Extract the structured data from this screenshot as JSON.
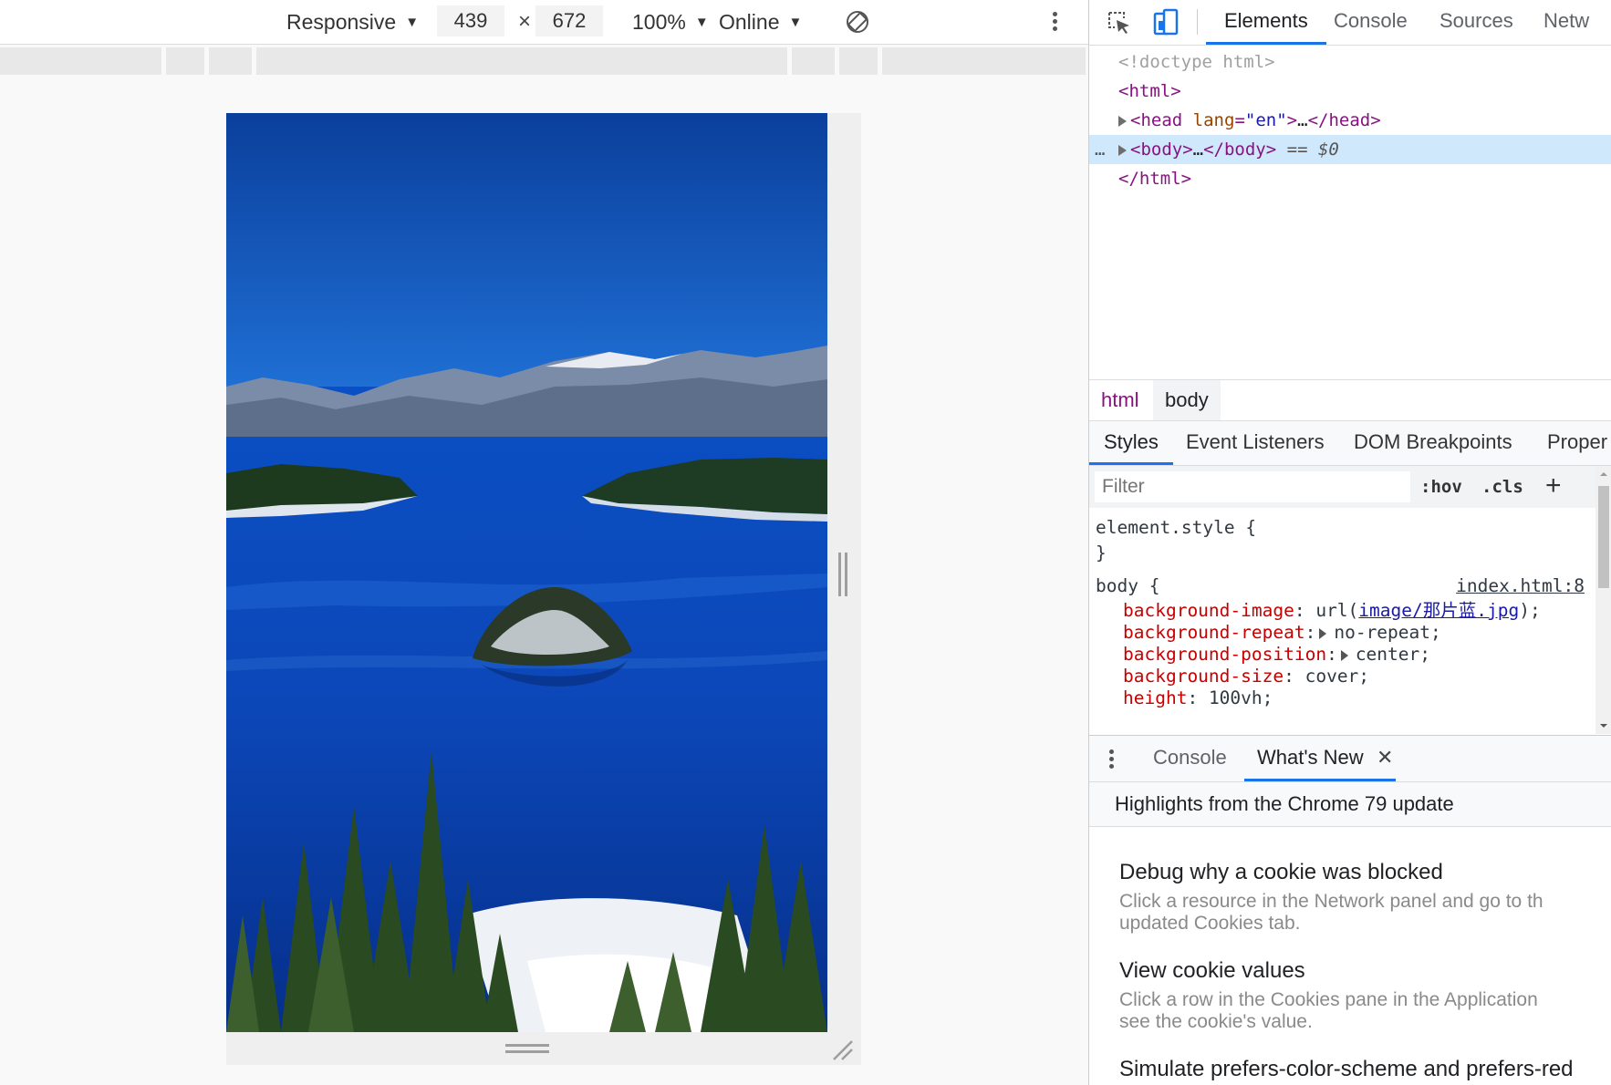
{
  "device_toolbar": {
    "device": "Responsive",
    "width": "439",
    "height": "672",
    "times": "×",
    "zoom": "100%",
    "throttle": "Online"
  },
  "devtools": {
    "tabs": [
      "Elements",
      "Console",
      "Sources",
      "Netw"
    ],
    "active_tab": "Elements"
  },
  "dom_tree": {
    "doctype": "<!doctype html>",
    "html_open": "<html>",
    "head_tag": "head",
    "head_attr_name": "lang",
    "head_attr_value": "\"en\"",
    "ellipsis": "…",
    "head_close": "</head>",
    "body_open": "<body>",
    "body_close": "</body>",
    "equals": "==",
    "dollar": "$0",
    "html_close": "</html>",
    "selected_dots": "…"
  },
  "breadcrumbs": [
    "html",
    "body"
  ],
  "styles_tabs": [
    "Styles",
    "Event Listeners",
    "DOM Breakpoints",
    "Proper"
  ],
  "styles_filter": {
    "placeholder": "Filter",
    "hov": ":hov",
    "cls": ".cls",
    "plus": "+"
  },
  "rules": {
    "element_style_open": "element.style {",
    "element_style_close": "}",
    "body_selector": "body {",
    "body_source": "index.html:8",
    "declarations": [
      {
        "prop": "background-image",
        "pre": "url(",
        "link": "image/那片蓝.jpg",
        "post": ");"
      },
      {
        "prop": "background-repeat",
        "value": "no-repeat;"
      },
      {
        "prop": "background-position",
        "value": "center;"
      },
      {
        "prop": "background-size",
        "value": "cover;"
      },
      {
        "prop": "height",
        "value": "100vh;"
      }
    ]
  },
  "drawer": {
    "tabs": [
      "Console",
      "What's New"
    ],
    "active_tab": "What's New",
    "close": "✕",
    "highlights": "Highlights from the Chrome 79 update",
    "items": [
      {
        "title": "Debug why a cookie was blocked",
        "desc": [
          "Click a resource in the Network panel and go to th",
          "updated Cookies tab."
        ]
      },
      {
        "title": "View cookie values",
        "desc": [
          "Click a row in the Cookies pane in the Application",
          "see the cookie's value."
        ]
      },
      {
        "title": "Simulate prefers-color-scheme and prefers-red",
        "desc": []
      }
    ]
  },
  "colors": {
    "accent": "#1a73e8",
    "tag": "#881280",
    "property": "#c80000",
    "selected_row": "#cfe8fc"
  }
}
